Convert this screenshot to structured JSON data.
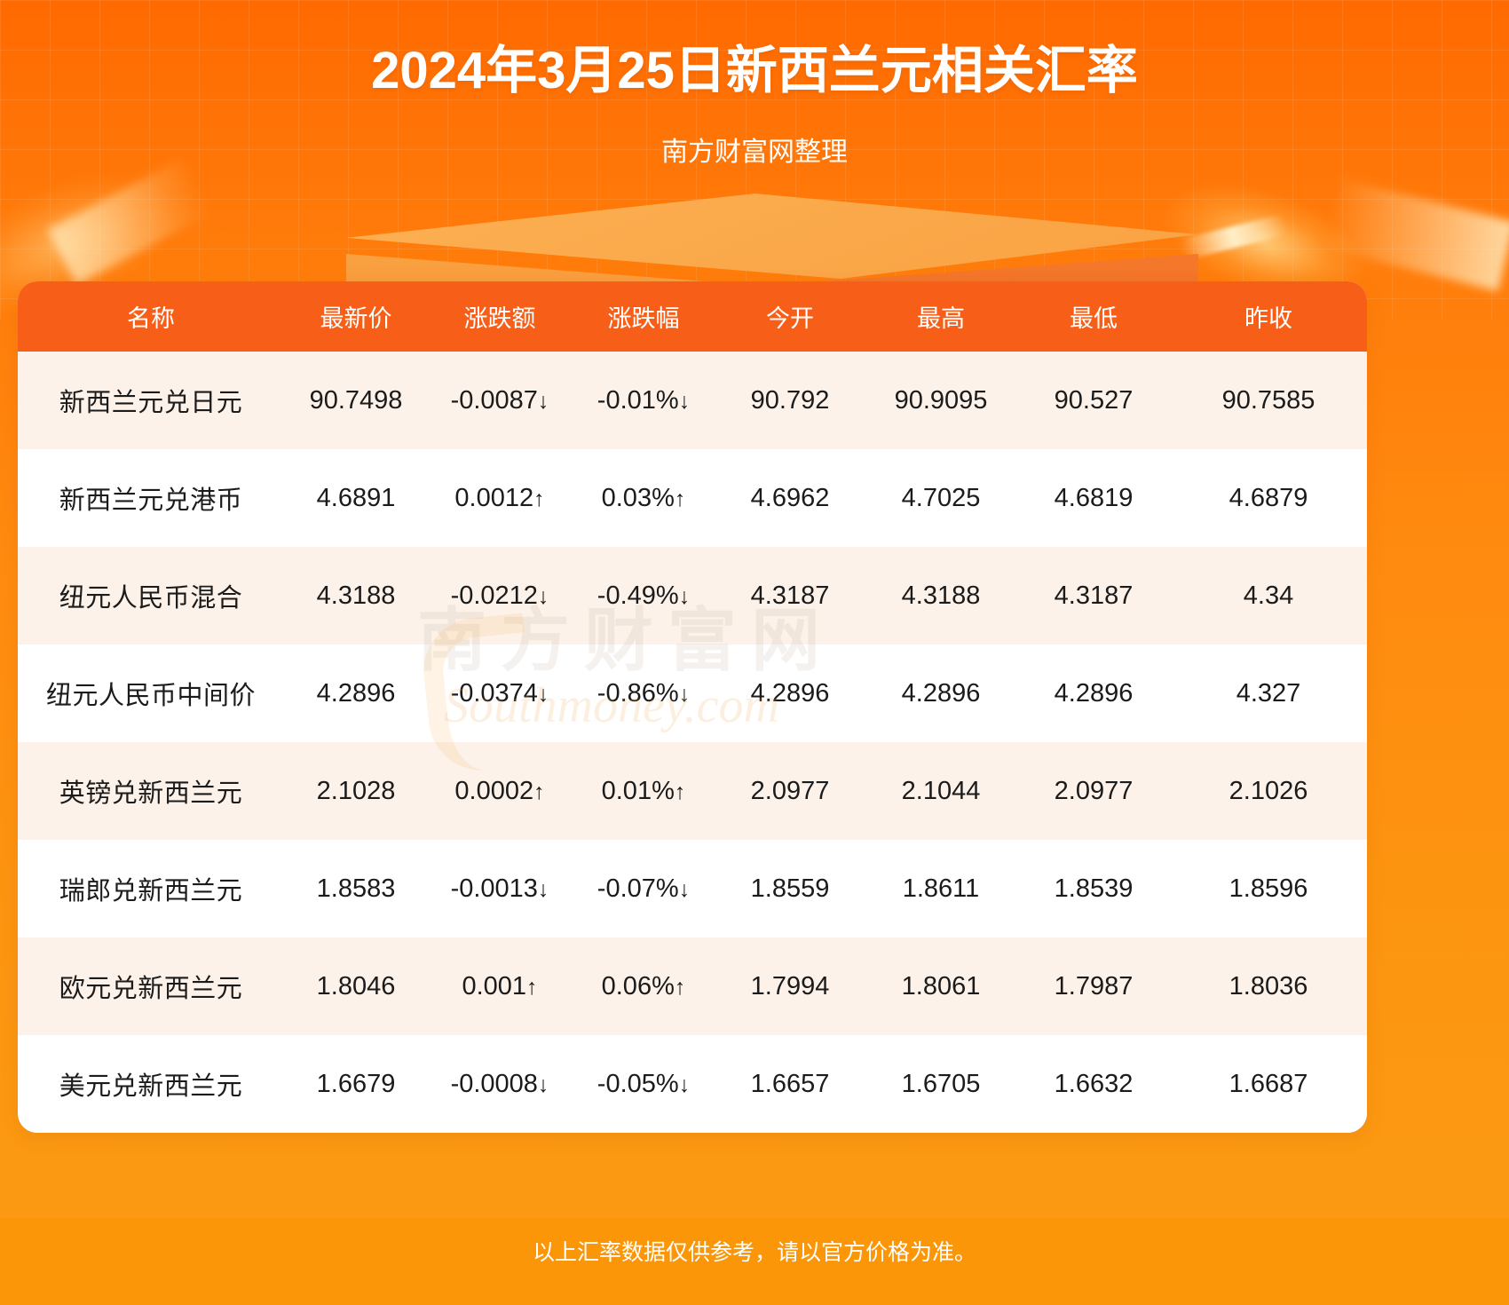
{
  "header": {
    "title": "2024年3月25日新西兰元相关汇率",
    "subtitle": "南方财富网整理"
  },
  "watermark": {
    "cn": "南方财富网",
    "en": "Southmoney.com"
  },
  "footer": {
    "note": "以上汇率数据仅供参考，请以官方价格为准。"
  },
  "colors": {
    "banner_top": "#FF6A00",
    "banner_bottom": "#FB9A12",
    "table_header": "#F75F18",
    "row_odd": "#FCF2EA",
    "row_even": "#FFFFFF",
    "up": "#E60B0B",
    "down": "#119218",
    "footer_bar": "#FB9608"
  },
  "table": {
    "columns": [
      "名称",
      "最新价",
      "涨跌额",
      "涨跌幅",
      "今开",
      "最高",
      "最低",
      "昨收"
    ],
    "rows": [
      {
        "name": "新西兰元兑日元",
        "last": "90.7498",
        "change": "-0.0087",
        "change_arrow": "↓",
        "pct": "-0.01%",
        "pct_arrow": "↓",
        "dir": "down",
        "open": "90.792",
        "high": "90.9095",
        "low": "90.527",
        "prev_close": "90.7585"
      },
      {
        "name": "新西兰元兑港币",
        "last": "4.6891",
        "change": "0.0012",
        "change_arrow": "↑",
        "pct": "0.03%",
        "pct_arrow": "↑",
        "dir": "up",
        "open": "4.6962",
        "high": "4.7025",
        "low": "4.6819",
        "prev_close": "4.6879"
      },
      {
        "name": "纽元人民币混合",
        "last": "4.3188",
        "change": "-0.0212",
        "change_arrow": "↓",
        "pct": "-0.49%",
        "pct_arrow": "↓",
        "dir": "down",
        "open": "4.3187",
        "high": "4.3188",
        "low": "4.3187",
        "prev_close": "4.34"
      },
      {
        "name": "纽元人民币中间价",
        "last": "4.2896",
        "change": "-0.0374",
        "change_arrow": "↓",
        "pct": "-0.86%",
        "pct_arrow": "↓",
        "dir": "down",
        "open": "4.2896",
        "high": "4.2896",
        "low": "4.2896",
        "prev_close": "4.327"
      },
      {
        "name": "英镑兑新西兰元",
        "last": "2.1028",
        "change": "0.0002",
        "change_arrow": "↑",
        "pct": "0.01%",
        "pct_arrow": "↑",
        "dir": "up",
        "open": "2.0977",
        "high": "2.1044",
        "low": "2.0977",
        "prev_close": "2.1026"
      },
      {
        "name": "瑞郎兑新西兰元",
        "last": "1.8583",
        "change": "-0.0013",
        "change_arrow": "↓",
        "pct": "-0.07%",
        "pct_arrow": "↓",
        "dir": "down",
        "open": "1.8559",
        "high": "1.8611",
        "low": "1.8539",
        "prev_close": "1.8596"
      },
      {
        "name": "欧元兑新西兰元",
        "last": "1.8046",
        "change": "0.001",
        "change_arrow": "↑",
        "pct": "0.06%",
        "pct_arrow": "↑",
        "dir": "up",
        "open": "1.7994",
        "high": "1.8061",
        "low": "1.7987",
        "prev_close": "1.8036"
      },
      {
        "name": "美元兑新西兰元",
        "last": "1.6679",
        "change": "-0.0008",
        "change_arrow": "↓",
        "pct": "-0.05%",
        "pct_arrow": "↓",
        "dir": "down",
        "open": "1.6657",
        "high": "1.6705",
        "low": "1.6632",
        "prev_close": "1.6687"
      }
    ]
  }
}
